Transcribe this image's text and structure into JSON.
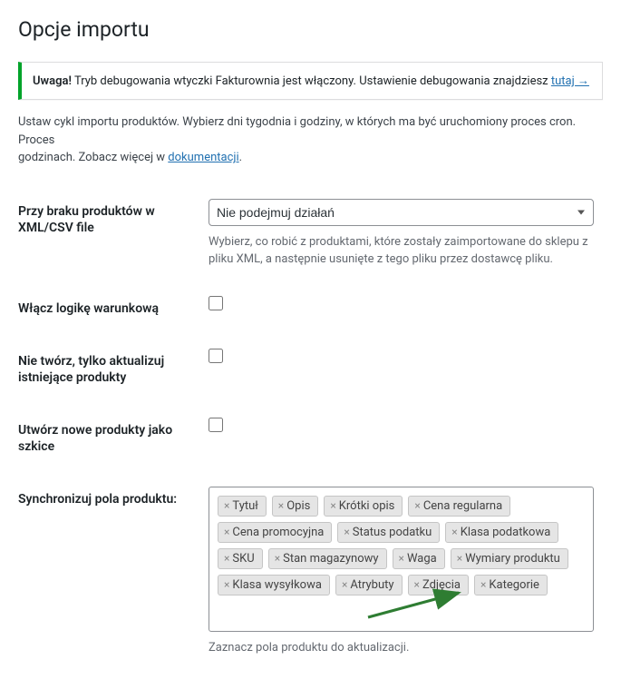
{
  "page": {
    "title": "Opcje importu"
  },
  "notice": {
    "strong": "Uwaga!",
    "text": " Tryb debugowania wtyczki Fakturownia jest włączony. Ustawienie debugowania znajdziesz ",
    "link": "tutaj →"
  },
  "intro": {
    "text1": "Ustaw cykl importu produktów. Wybierz dni tygodnia i godziny, w których ma być uruchomiony proces cron. Proces",
    "text2": "godzinach. Zobacz więcej w ",
    "link": "dokumentacji",
    "period": "."
  },
  "fields": {
    "missing_products": {
      "label": "Przy braku produktów w XML/CSV file",
      "selected": "Nie podejmuj działań",
      "description": "Wybierz, co robić z produktami, które zostały zaimportowane do sklepu z pliku XML, a następnie usunięte z tego pliku przez dostawcę pliku."
    },
    "conditional_logic": {
      "label": "Włącz logikę warunkową"
    },
    "update_only": {
      "label": "Nie twórz, tylko aktualizuj istniejące produkty"
    },
    "create_drafts": {
      "label": "Utwórz nowe produkty jako szkice"
    },
    "sync_fields": {
      "label": "Synchronizuj pola produktu:",
      "description": "Zaznacz pola produktu do aktualizacji.",
      "tags": [
        "Tytuł",
        "Opis",
        "Krótki opis",
        "Cena regularna",
        "Cena promocyjna",
        "Status podatku",
        "Klasa podatkowa",
        "SKU",
        "Stan magazynowy",
        "Waga",
        "Wymiary produktu",
        "Klasa wysyłkowa",
        "Atrybuty",
        "Zdjęcia",
        "Kategorie"
      ]
    }
  }
}
